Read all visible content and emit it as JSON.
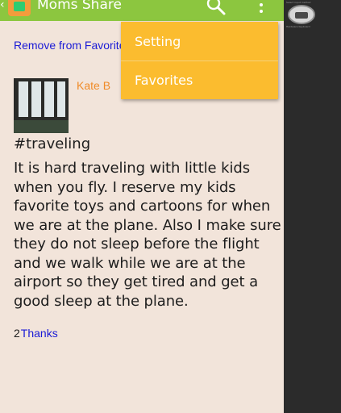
{
  "action_bar": {
    "title": "Moms Share",
    "back_glyph": "‹",
    "icons": {
      "app": "house-icon",
      "search": "search-icon",
      "overflow": "overflow-menu-icon"
    },
    "color": "#8cc63f"
  },
  "content": {
    "remove_link": "Remove from Favorites",
    "author": "Kate B",
    "tag": "#traveling",
    "body": "It is hard traveling with little kids when you fly. I reserve my kids favorite toys and cartoons for when we are at the plane. Also I make sure they do not sleep before the flight and we walk while we are at the airport so they get tired and get a good sleep at the plane.",
    "thanks_count": "2",
    "thanks_label": "Thanks",
    "background": "#f2e4da"
  },
  "overflow_menu": {
    "items": [
      {
        "label": "Setting"
      },
      {
        "label": "Favorites"
      }
    ],
    "color": "#fbbc2f"
  },
  "side_panel": {
    "caption_top": "Select input method",
    "caption_bottom": "Hardware Keyboard",
    "icon": "keyboard-icon"
  }
}
